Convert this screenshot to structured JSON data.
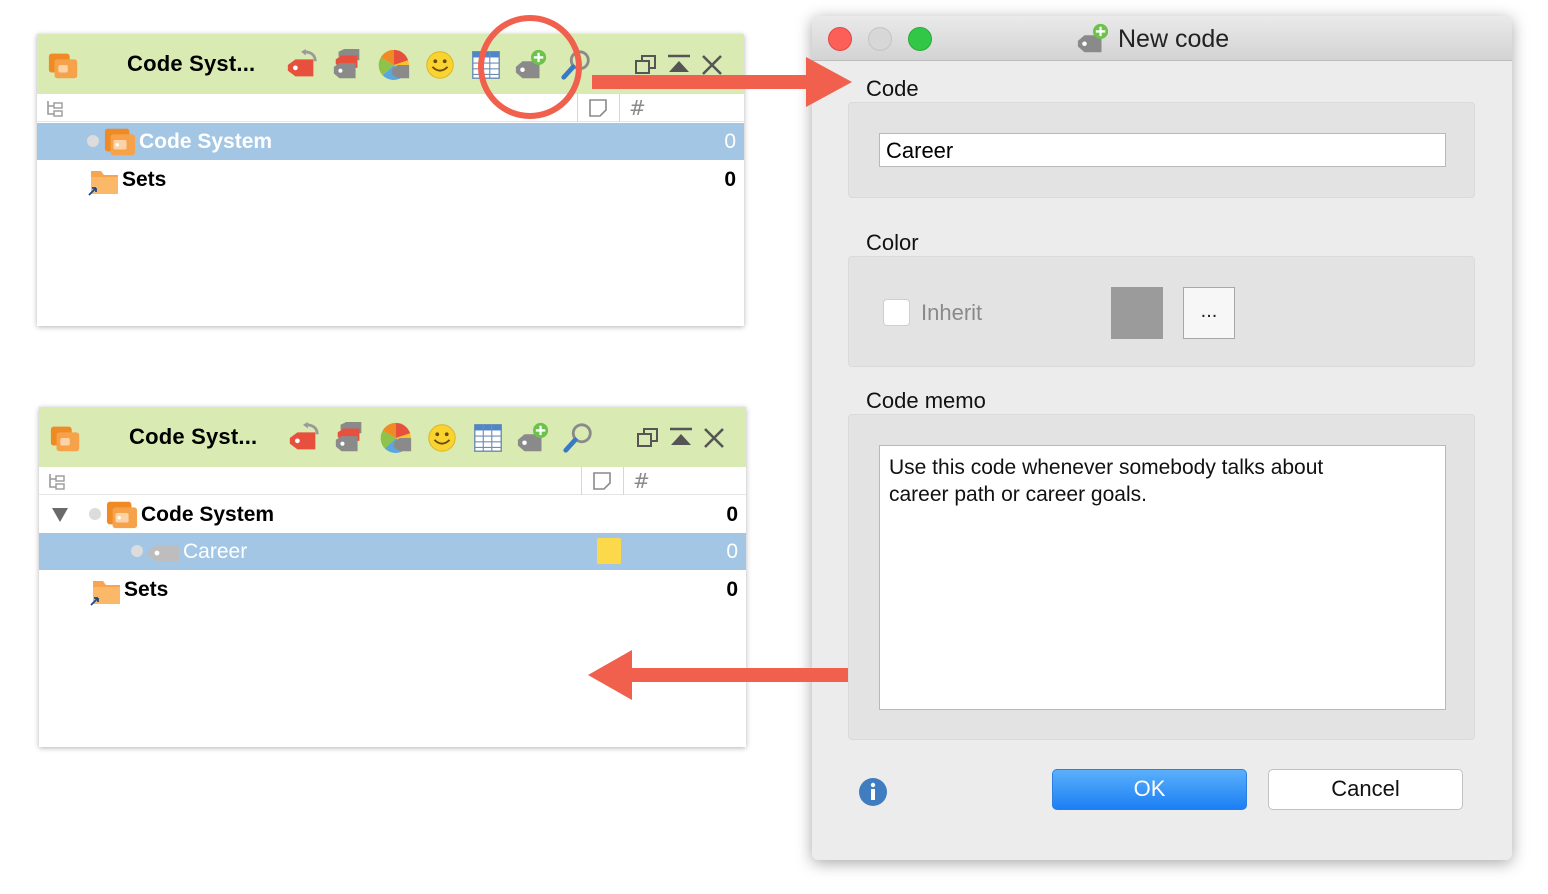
{
  "top_panel": {
    "title": "Code Syst...",
    "columns": {
      "memo": "memo",
      "count": "#"
    },
    "rows": [
      {
        "label": "Code System",
        "count": "0",
        "selected": true
      },
      {
        "label": "Sets",
        "count": "0",
        "selected": false
      }
    ]
  },
  "bottom_panel": {
    "title": "Code Syst...",
    "columns": {
      "memo": "memo",
      "count": "#"
    },
    "rows": [
      {
        "label": "Code System",
        "count": "0",
        "selected": false,
        "expanded": true
      },
      {
        "label": "Career",
        "count": "0",
        "selected": true,
        "has_memo": true
      },
      {
        "label": "Sets",
        "count": "0",
        "selected": false
      }
    ]
  },
  "toolbar_icons": [
    "activate-icon",
    "code-sets-icon",
    "color-codes-icon",
    "emoticode-icon",
    "code-matrix-icon",
    "new-code-icon",
    "search-icon"
  ],
  "window_controls": [
    "undock-icon",
    "collapse-icon",
    "close-icon"
  ],
  "dialog": {
    "title": "New code",
    "code_label": "Code",
    "code_value": "Career",
    "color_label": "Color",
    "inherit_label": "Inherit",
    "inherit_checked": false,
    "color_value": "#9b9b9b",
    "more_button": "...",
    "memo_label": "Code memo",
    "memo_text": "Use this code whenever somebody talks about\ncareer path or career goals.",
    "ok_label": "OK",
    "cancel_label": "Cancel"
  },
  "colors": {
    "toolbar_bg": "#d9eab2",
    "selection": "#a2c6e4",
    "arrow": "#f0604d",
    "memo_note": "#fbd94b",
    "ok_button": "#1b7ff4"
  }
}
